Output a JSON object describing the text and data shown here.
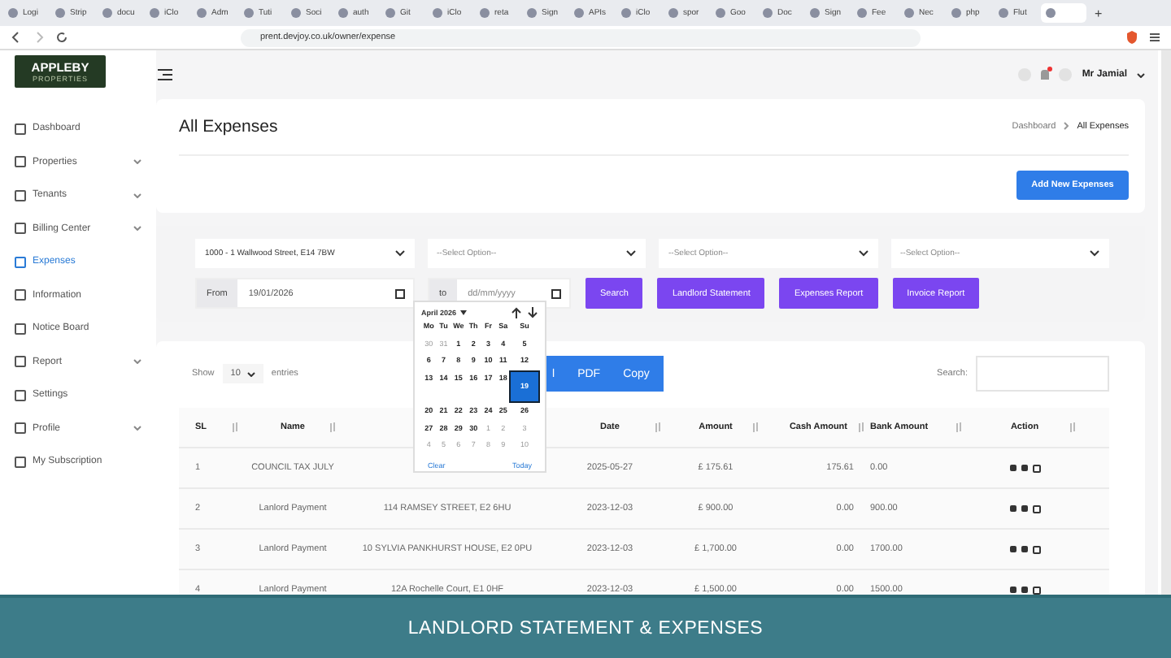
{
  "browser": {
    "tabs": [
      {
        "label": "Logi",
        "selected": false
      },
      {
        "label": "Strip",
        "selected": false
      },
      {
        "label": "docu",
        "selected": false
      },
      {
        "label": "iClo",
        "selected": false
      },
      {
        "label": "Adm",
        "selected": false
      },
      {
        "label": "Tuti",
        "selected": false
      },
      {
        "label": "Soci",
        "selected": false
      },
      {
        "label": "auth",
        "selected": false
      },
      {
        "label": "Git",
        "selected": false
      },
      {
        "label": "iClo",
        "selected": false
      },
      {
        "label": "reta",
        "selected": false
      },
      {
        "label": "Sign",
        "selected": false
      },
      {
        "label": "APIs",
        "selected": false
      },
      {
        "label": "iClo",
        "selected": false
      },
      {
        "label": "spor",
        "selected": false
      },
      {
        "label": "Goo",
        "selected": false
      },
      {
        "label": "Doc",
        "selected": false
      },
      {
        "label": "Sign",
        "selected": false
      },
      {
        "label": "Fee",
        "selected": false
      },
      {
        "label": "Nec",
        "selected": false
      },
      {
        "label": "php",
        "selected": false
      },
      {
        "label": "Flut",
        "selected": false
      },
      {
        "selected": true
      }
    ],
    "new_tab": "+",
    "url": "prent.devjoy.co.uk/owner/expense"
  },
  "logo": {
    "name": "APPLEBY",
    "tagline": "PROPERTIES"
  },
  "sidebar": {
    "items": [
      {
        "label": "Dashboard",
        "kind": "link",
        "selected": false
      },
      {
        "label": "Properties",
        "kind": "group",
        "selected": false
      },
      {
        "label": "Tenants",
        "kind": "group",
        "selected": false
      },
      {
        "label": "Billing Center",
        "kind": "group",
        "selected": false
      },
      {
        "label": "Expenses",
        "kind": "link",
        "selected": true
      },
      {
        "label": "Information",
        "kind": "link",
        "selected": false
      },
      {
        "label": "Notice Board",
        "kind": "link",
        "selected": false
      },
      {
        "label": "Report",
        "kind": "group",
        "selected": false
      },
      {
        "label": "Settings",
        "kind": "link",
        "selected": false
      },
      {
        "label": "Profile",
        "kind": "group",
        "selected": false
      },
      {
        "label": "My Subscription",
        "kind": "link",
        "selected": false
      }
    ]
  },
  "user": {
    "name": "Mr Jamial",
    "notification": true
  },
  "page": {
    "title": "All Expenses",
    "breadcrumb": [
      "Dashboard",
      "All Expenses"
    ],
    "add_button": "Add New Expenses"
  },
  "filters": {
    "selects": [
      "1000 - 1 Wallwood Street, E14 7BW",
      "--Select Option--",
      "--Select Option--",
      "--Select Option--"
    ],
    "from_label": "From",
    "from_value": "19/01/2026",
    "to_label": "to",
    "to_placeholder": "dd/mm/yyyy",
    "buttons": [
      "Search",
      "Landlord Statement",
      "Expenses Report",
      "Invoice Report"
    ]
  },
  "datepicker": {
    "month": "April 2026",
    "weekdays": [
      "Mo",
      "Tu",
      "We",
      "Th",
      "Fr",
      "Sa",
      "Su"
    ],
    "days": [
      {
        "day": "30",
        "muted": true,
        "selected": false
      },
      {
        "day": "31",
        "muted": true,
        "selected": false
      },
      {
        "day": "1",
        "muted": false,
        "selected": false
      },
      {
        "day": "2",
        "muted": false,
        "selected": false
      },
      {
        "day": "3",
        "muted": false,
        "selected": false
      },
      {
        "day": "4",
        "muted": false,
        "selected": false
      },
      {
        "day": "5",
        "muted": false,
        "selected": false
      },
      {
        "day": "6",
        "muted": false,
        "selected": false
      },
      {
        "day": "7",
        "muted": false,
        "selected": false
      },
      {
        "day": "8",
        "muted": false,
        "selected": false
      },
      {
        "day": "9",
        "muted": false,
        "selected": false
      },
      {
        "day": "10",
        "muted": false,
        "selected": false
      },
      {
        "day": "11",
        "muted": false,
        "selected": false
      },
      {
        "day": "12",
        "muted": false,
        "selected": false
      },
      {
        "day": "13",
        "muted": false,
        "selected": false
      },
      {
        "day": "14",
        "muted": false,
        "selected": false
      },
      {
        "day": "15",
        "muted": false,
        "selected": false
      },
      {
        "day": "16",
        "muted": false,
        "selected": false
      },
      {
        "day": "17",
        "muted": false,
        "selected": false
      },
      {
        "day": "18",
        "muted": false,
        "selected": false
      },
      {
        "day": "19",
        "muted": false,
        "selected": true
      },
      {
        "day": "20",
        "muted": false,
        "selected": false
      },
      {
        "day": "21",
        "muted": false,
        "selected": false
      },
      {
        "day": "22",
        "muted": false,
        "selected": false
      },
      {
        "day": "23",
        "muted": false,
        "selected": false
      },
      {
        "day": "24",
        "muted": false,
        "selected": false
      },
      {
        "day": "25",
        "muted": false,
        "selected": false
      },
      {
        "day": "26",
        "muted": false,
        "selected": false
      },
      {
        "day": "27",
        "muted": false,
        "selected": false
      },
      {
        "day": "28",
        "muted": false,
        "selected": false
      },
      {
        "day": "29",
        "muted": false,
        "selected": false
      },
      {
        "day": "30",
        "muted": false,
        "selected": false
      },
      {
        "day": "1",
        "muted": true,
        "selected": false
      },
      {
        "day": "2",
        "muted": true,
        "selected": false
      },
      {
        "day": "3",
        "muted": true,
        "selected": false
      },
      {
        "day": "4",
        "muted": true,
        "selected": false
      },
      {
        "day": "5",
        "muted": true,
        "selected": false
      },
      {
        "day": "6",
        "muted": true,
        "selected": false
      },
      {
        "day": "7",
        "muted": true,
        "selected": false
      },
      {
        "day": "8",
        "muted": true,
        "selected": false
      },
      {
        "day": "9",
        "muted": true,
        "selected": false
      },
      {
        "day": "10",
        "muted": true,
        "selected": false
      }
    ],
    "clear": "Clear",
    "today": "Today"
  },
  "table": {
    "show_label": "Show",
    "page_size": "10",
    "entries_label": "entries",
    "export_buttons": [
      "l",
      "PDF",
      "Copy"
    ],
    "search_label": "Search:",
    "columns": [
      "SL",
      "Name",
      "",
      "Date",
      "Amount",
      "Cash Amount",
      "Bank Amount",
      "Action"
    ],
    "rows": [
      {
        "sl": "1",
        "name": "COUNCIL TAX JULY",
        "date": "2025-05-27",
        "amount": "£ 175.61",
        "cash": "175.61",
        "bank": "0.00"
      },
      {
        "sl": "2",
        "name": "Lanlord Payment",
        "address": "114 RAMSEY STREET, E2 6HU",
        "date": "2023-12-03",
        "amount": "£ 900.00",
        "cash": "0.00",
        "bank": "900.00"
      },
      {
        "sl": "3",
        "name": "Lanlord Payment",
        "address": "10 SYLVIA PANKHURST HOUSE, E2 0PU",
        "date": "2023-12-03",
        "amount": "£ 1,700.00",
        "cash": "0.00",
        "bank": "1700.00"
      },
      {
        "sl": "4",
        "name": "Lanlord Payment",
        "address": "12A Rochelle Court, E1 0HF",
        "date": "2023-12-03",
        "amount": "£ 1,500.00",
        "cash": "0.00",
        "bank": "1500.00"
      }
    ]
  },
  "caption": "LANDLORD STATEMENT & EXPENSES"
}
